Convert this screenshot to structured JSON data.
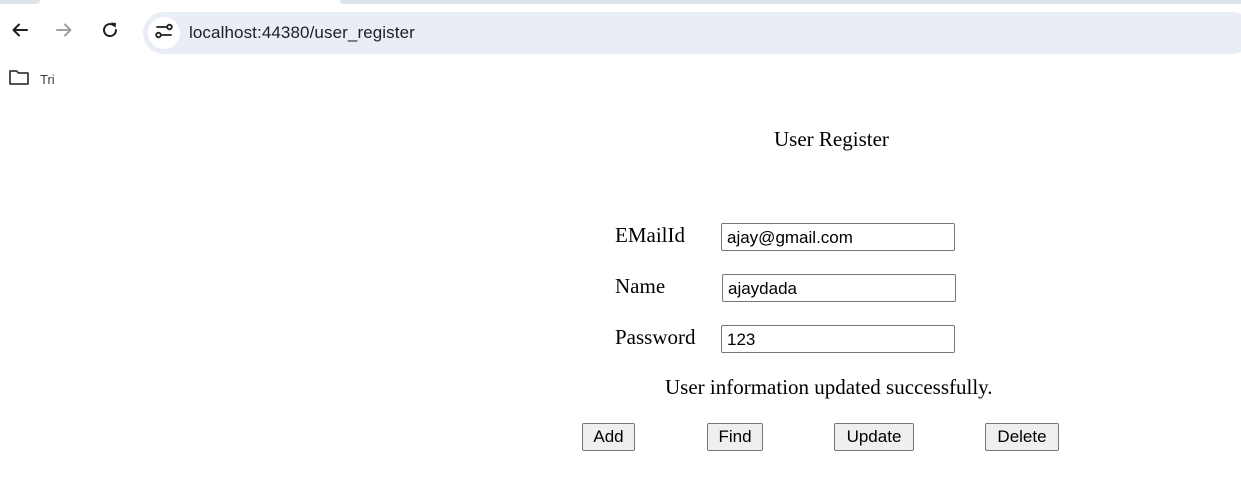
{
  "browser": {
    "url": "localhost:44380/user_register",
    "bookmarks": [
      {
        "label": "Tri",
        "icon": "folder-icon"
      }
    ],
    "nav_icons": [
      "back-arrow-icon",
      "forward-arrow-icon",
      "reload-icon",
      "site-settings-icon"
    ]
  },
  "form": {
    "title": "User Register",
    "fields": [
      {
        "label": "EMailId",
        "value": "ajay@gmail.com"
      },
      {
        "label": "Name",
        "value": "ajaydada"
      },
      {
        "label": "Password",
        "value": "123"
      }
    ],
    "status_message": "User information updated successfully.",
    "buttons": {
      "add": "Add",
      "find": "Find",
      "update": "Update",
      "delete": "Delete"
    }
  }
}
